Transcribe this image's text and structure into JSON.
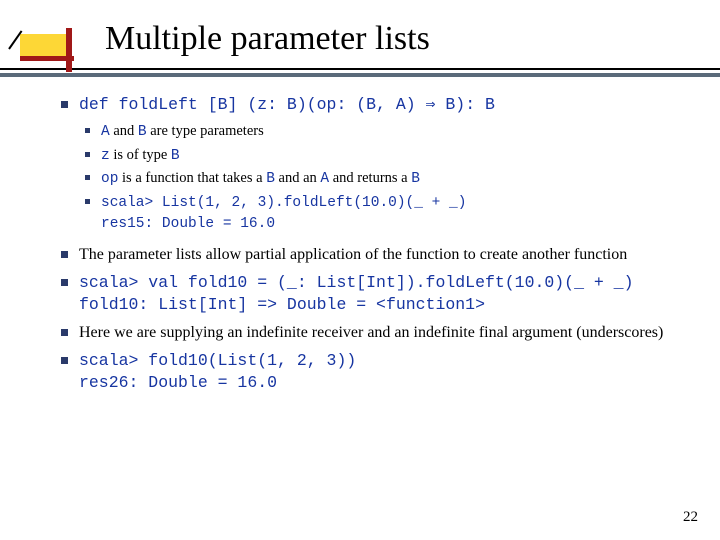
{
  "title": "Multiple parameter lists",
  "page_number": "22",
  "bullets": {
    "b1": "def foldLeft [B] (z: B)(op: (B, A) ⇒ B): B",
    "sub": {
      "s1a": "A",
      "s1b": " and ",
      "s1c": "B",
      "s1d": " are type parameters",
      "s2a": "z",
      "s2b": " is of type ",
      "s2c": "B",
      "s3a": "op",
      "s3b": " is a function that takes a ",
      "s3c": "B",
      "s3d": " and an ",
      "s3e": "A",
      "s3f": " and returns a ",
      "s3g": "B",
      "s4a": "scala> List(1, 2, 3).foldLeft(10.0)(_ + _)",
      "s4b": "res15: Double = 16.0"
    },
    "b2": "The parameter lists allow partial application of the function to create another function",
    "b3a": "scala> val fold10 = (_: List[Int]).foldLeft(10.0)(_ + _)",
    "b3b": "fold10: List[Int] => Double = <function1>",
    "b4": "Here we are supplying an indefinite receiver and an indefinite final argument (underscores)",
    "b5a": "scala> fold10(List(1, 2, 3))",
    "b5b": "res26: Double = 16.0"
  }
}
